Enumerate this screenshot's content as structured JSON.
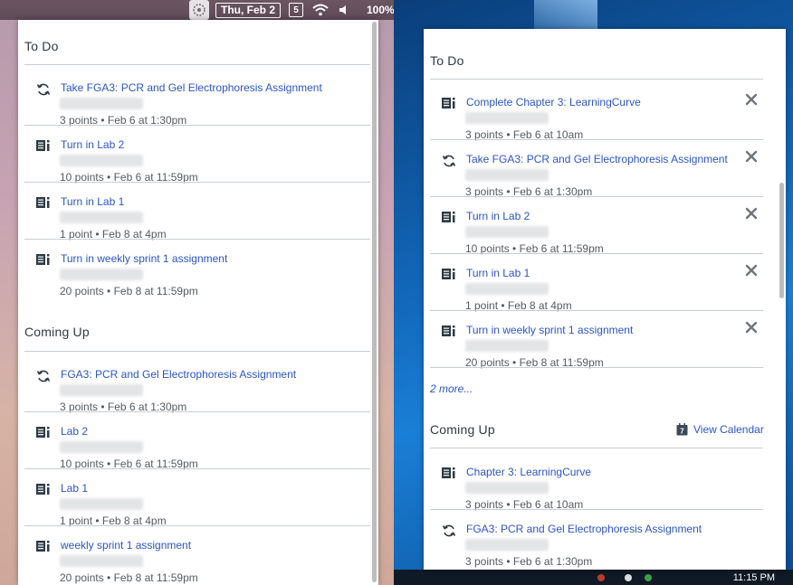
{
  "menubar": {
    "date": "Thu, Feb 2",
    "html5_badge": "5",
    "battery": "100%"
  },
  "taskbar": {
    "time": "11:15 PM"
  },
  "left_panel": {
    "todo_title": "To Do",
    "todo_items": [
      {
        "icon": "sync-icon",
        "title": "Take FGA3: PCR and Gel Electrophoresis Assignment",
        "meta": "3 points • Feb 6 at 1:30pm"
      },
      {
        "icon": "assignment-icon",
        "title": "Turn in Lab 2",
        "meta": "10 points • Feb 6 at 11:59pm"
      },
      {
        "icon": "assignment-icon",
        "title": "Turn in Lab 1",
        "meta": "1 point • Feb 8 at 4pm"
      },
      {
        "icon": "assignment-icon",
        "title": "Turn in weekly sprint 1 assignment",
        "meta": "20 points • Feb 8 at 11:59pm"
      }
    ],
    "coming_title": "Coming Up",
    "coming_items": [
      {
        "icon": "sync-icon",
        "title": "FGA3: PCR and Gel Electrophoresis Assignment",
        "meta": "3 points • Feb 6 at 1:30pm"
      },
      {
        "icon": "assignment-icon",
        "title": "Lab 2",
        "meta": "10 points • Feb 6 at 11:59pm"
      },
      {
        "icon": "assignment-icon",
        "title": "Lab 1",
        "meta": "1 point • Feb 8 at 4pm"
      },
      {
        "icon": "assignment-icon",
        "title": "weekly sprint 1 assignment",
        "meta": "20 points • Feb 8 at 11:59pm"
      }
    ]
  },
  "right_panel": {
    "todo_title": "To Do",
    "todo_items": [
      {
        "icon": "assignment-icon",
        "title": "Complete Chapter 3: LearningCurve",
        "meta": "3 points • Feb 6 at 10am"
      },
      {
        "icon": "sync-icon",
        "title": "Take FGA3: PCR and Gel Electrophoresis Assignment",
        "meta": "3 points • Feb 6 at 1:30pm"
      },
      {
        "icon": "assignment-icon",
        "title": "Turn in Lab 2",
        "meta": "10 points • Feb 6 at 11:59pm"
      },
      {
        "icon": "assignment-icon",
        "title": "Turn in Lab 1",
        "meta": "1 point • Feb 8 at 4pm"
      },
      {
        "icon": "assignment-icon",
        "title": "Turn in weekly sprint 1 assignment",
        "meta": "20 points • Feb 8 at 11:59pm"
      }
    ],
    "more_link": "2 more...",
    "coming_title": "Coming Up",
    "view_calendar": "View Calendar",
    "coming_items": [
      {
        "icon": "assignment-icon",
        "title": "Chapter 3: LearningCurve",
        "meta": "3 points • Feb 6 at 10am"
      },
      {
        "icon": "sync-icon",
        "title": "FGA3: PCR and Gel Electrophoresis Assignment",
        "meta": "3 points • Feb 6 at 1:30pm"
      }
    ]
  }
}
